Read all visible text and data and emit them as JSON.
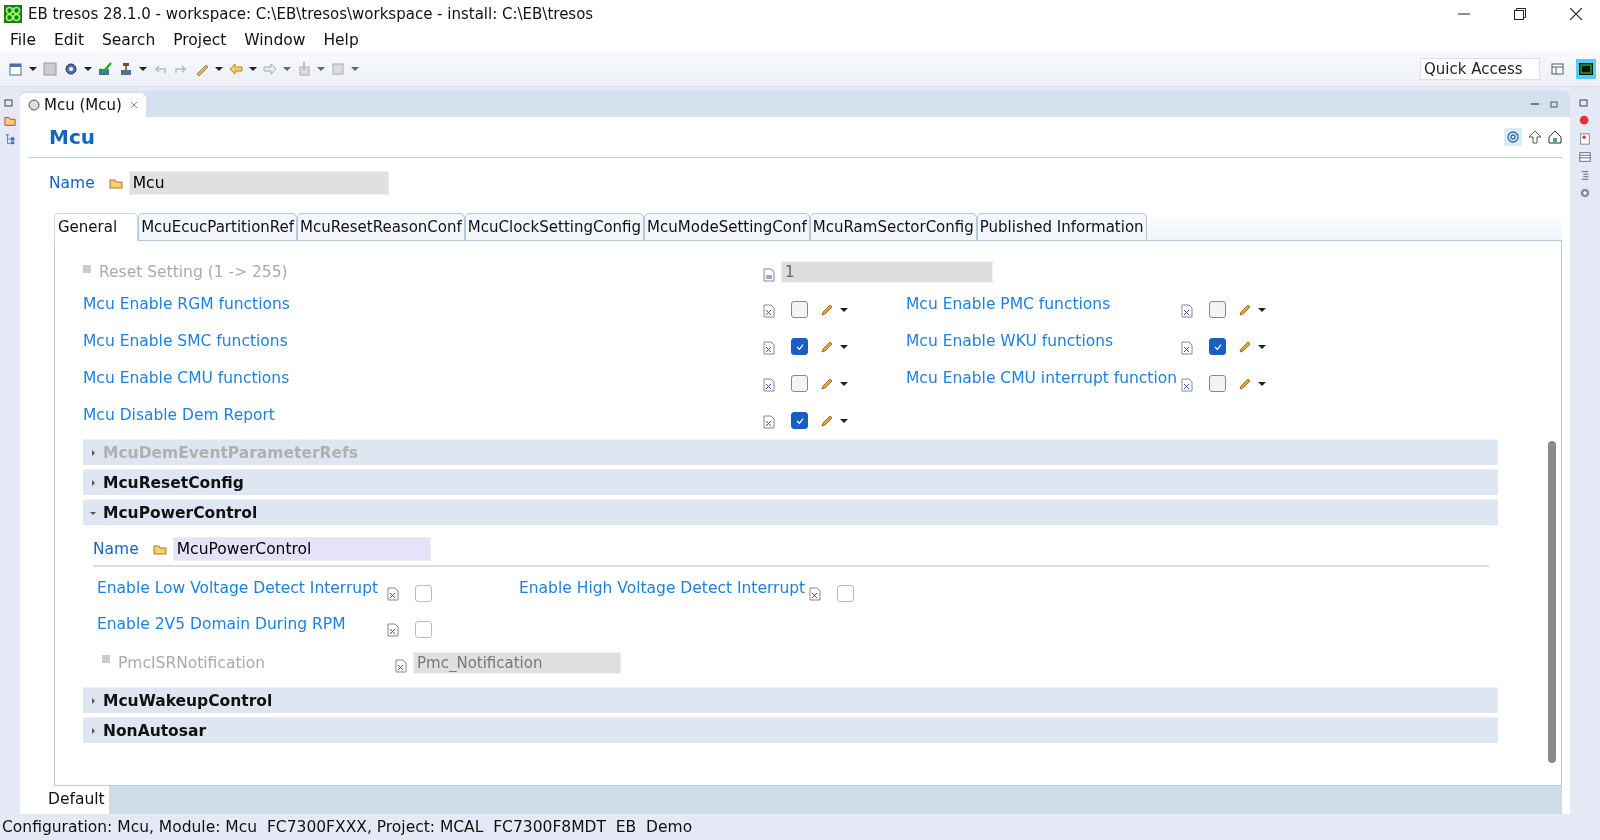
{
  "window": {
    "title": "EB tresos 28.1.0 - workspace: C:\\EB\\tresos\\workspace - install: C:\\EB\\tresos"
  },
  "menu": [
    "File",
    "Edit",
    "Search",
    "Project",
    "Window",
    "Help"
  ],
  "quick_access": {
    "placeholder": "Quick Access"
  },
  "editor_tab": {
    "label": "Mcu (Mcu)"
  },
  "heading": "Mcu",
  "name_field": {
    "label": "Name",
    "value": "Mcu"
  },
  "tabs": [
    {
      "label": "General",
      "selected": true
    },
    {
      "label": "McuEcucPartitionRef",
      "selected": false
    },
    {
      "label": "McuResetReasonConf",
      "selected": false
    },
    {
      "label": "McuClockSettingConfig",
      "selected": false
    },
    {
      "label": "McuModeSettingConf",
      "selected": false
    },
    {
      "label": "McuRamSectorConfig",
      "selected": false
    },
    {
      "label": "Published Information",
      "selected": false
    }
  ],
  "reset_setting": {
    "label": "Reset Setting (1 -> 255)",
    "value": "1"
  },
  "option_rows": [
    [
      {
        "label": "Mcu Enable RGM functions",
        "checked": false
      },
      {
        "label": "Mcu Enable PMC functions",
        "checked": false
      }
    ],
    [
      {
        "label": "Mcu Enable SMC functions",
        "checked": true
      },
      {
        "label": "Mcu Enable WKU functions",
        "checked": true
      }
    ],
    [
      {
        "label": "Mcu Enable CMU functions",
        "checked": false
      },
      {
        "label": "Mcu Enable CMU interrupt function",
        "checked": false
      }
    ],
    [
      {
        "label": "Mcu Disable Dem Report",
        "checked": true
      }
    ]
  ],
  "sections": [
    {
      "title": "McuDemEventParameterRefs",
      "expanded": false,
      "disabled": true
    },
    {
      "title": "McuResetConfig",
      "expanded": false,
      "disabled": false
    },
    {
      "title": "McuPowerControl",
      "expanded": true,
      "disabled": false,
      "name_field": {
        "label": "Name",
        "value": "McuPowerControl"
      },
      "option_rows": [
        [
          {
            "label": "Enable Low Voltage Detect Interrupt",
            "checked": false
          },
          {
            "label": "Enable High Voltage Detect Interrupt",
            "checked": false
          }
        ],
        [
          {
            "label": "Enable 2V5 Domain During RPM",
            "checked": false
          }
        ]
      ],
      "notification": {
        "label": "PmcISRNotification",
        "value": "Pmc_Notification"
      }
    },
    {
      "title": "McuWakeupControl",
      "expanded": false,
      "disabled": false
    },
    {
      "title": "NonAutosar",
      "expanded": false,
      "disabled": false
    }
  ],
  "bottom_tab": {
    "label": "Default"
  },
  "status_bar": "Configuration: Mcu, Module: Mcu  FC7300FXXX, Project: MCAL  FC7300F8MDT  EB  Demo"
}
